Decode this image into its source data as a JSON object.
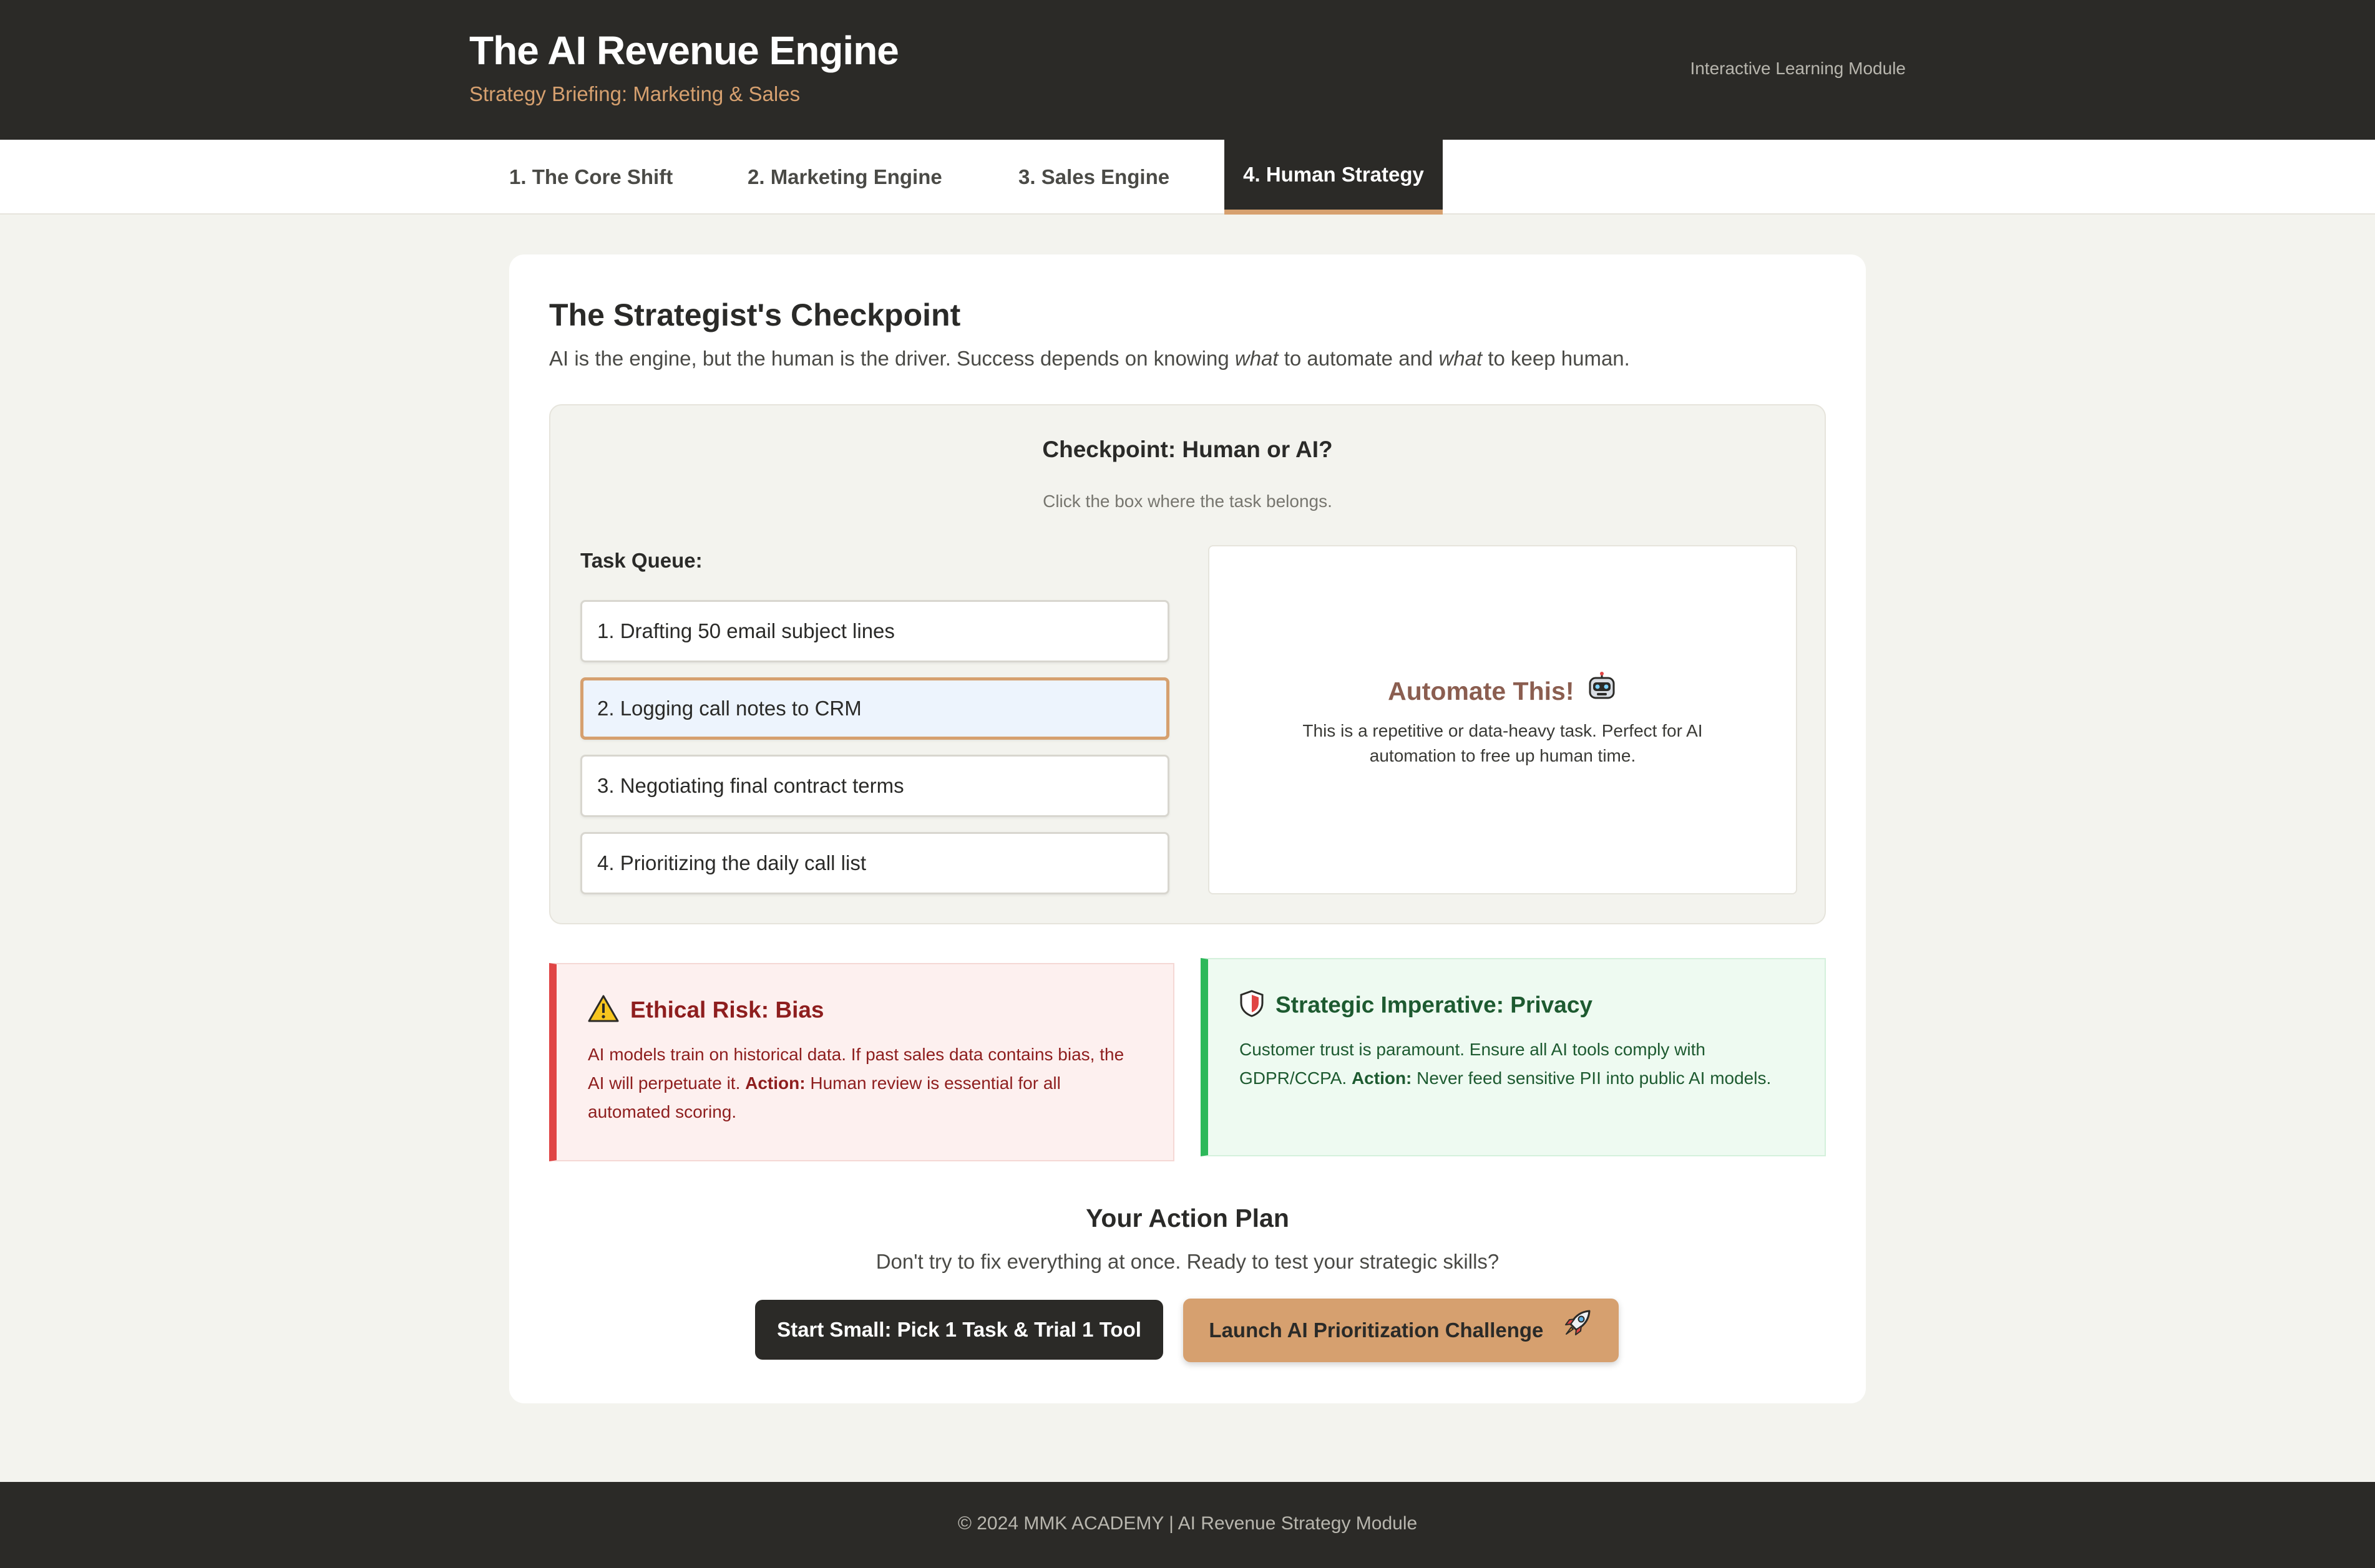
{
  "header": {
    "title": "The AI Revenue Engine",
    "subtitle": "Strategy Briefing: Marketing & Sales",
    "module_label": "Interactive Learning Module"
  },
  "tabs": [
    {
      "label": "1. The Core Shift",
      "active": false
    },
    {
      "label": "2. Marketing Engine",
      "active": false
    },
    {
      "label": "3. Sales Engine",
      "active": false
    },
    {
      "label": "4. Human Strategy",
      "active": true
    }
  ],
  "main": {
    "title": "The Strategist's Checkpoint",
    "lead_before": "AI is the engine, but the human is the driver. Success depends on knowing ",
    "lead_em1": "what",
    "lead_middle": " to automate and ",
    "lead_em2": "what",
    "lead_after": " to keep human."
  },
  "checkpoint": {
    "title": "Checkpoint: Human or AI?",
    "instruction": "Click the box where the task belongs.",
    "queue_label": "Task Queue:",
    "tasks": [
      {
        "label": "1. Drafting 50 email subject lines",
        "selected": false
      },
      {
        "label": "2. Logging call notes to CRM",
        "selected": true
      },
      {
        "label": "3. Negotiating final contract terms",
        "selected": false
      },
      {
        "label": "4. Prioritizing the daily call list",
        "selected": false
      }
    ],
    "result": {
      "title": "Automate This!",
      "icon": "robot-icon",
      "text": "This is a repetitive or data-heavy task. Perfect for AI automation to free up human time."
    }
  },
  "risk": {
    "icon": "warning-icon",
    "title": "Ethical Risk: Bias",
    "text": "AI models train on historical data. If past sales data contains bias, the AI will perpetuate it.",
    "action_label": "Action:",
    "action_text": "Human review is essential for all automated scoring."
  },
  "privacy": {
    "icon": "shield-icon",
    "title": "Strategic Imperative: Privacy",
    "text": "Customer trust is paramount. Ensure all AI tools comply with GDPR/CCPA.",
    "action_label": "Action:",
    "action_text": "Never feed sensitive PII into public AI models."
  },
  "action_plan": {
    "title": "Your Action Plan",
    "subtitle": "Don't try to fix everything at once. Ready to test your strategic skills?",
    "primary_button": "Start Small: Pick 1 Task & Trial 1 Tool",
    "secondary_button": "Launch AI Prioritization Challenge",
    "secondary_icon": "rocket-icon"
  },
  "footer": {
    "text": "© 2024 MMK ACADEMY | AI Revenue Strategy Module"
  },
  "colors": {
    "dark": "#2b2a27",
    "accent": "#d6a06f",
    "risk": "#e04545",
    "privacy": "#2db85a"
  }
}
